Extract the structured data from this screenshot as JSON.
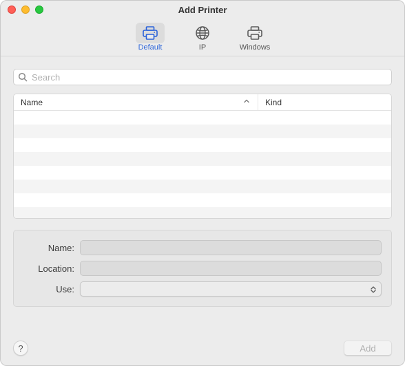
{
  "window": {
    "title": "Add Printer"
  },
  "toolbar": {
    "items": [
      {
        "id": "default",
        "label": "Default",
        "selected": true
      },
      {
        "id": "ip",
        "label": "IP",
        "selected": false
      },
      {
        "id": "windows",
        "label": "Windows",
        "selected": false
      }
    ]
  },
  "search": {
    "placeholder": "Search",
    "value": ""
  },
  "table": {
    "columns": {
      "name": "Name",
      "kind": "Kind"
    },
    "sort_column": "name",
    "sort_direction": "asc",
    "rows": []
  },
  "form": {
    "name": {
      "label": "Name:",
      "value": ""
    },
    "location": {
      "label": "Location:",
      "value": ""
    },
    "use": {
      "label": "Use:",
      "value": ""
    }
  },
  "footer": {
    "help_label": "?",
    "add_label": "Add",
    "add_enabled": false
  }
}
